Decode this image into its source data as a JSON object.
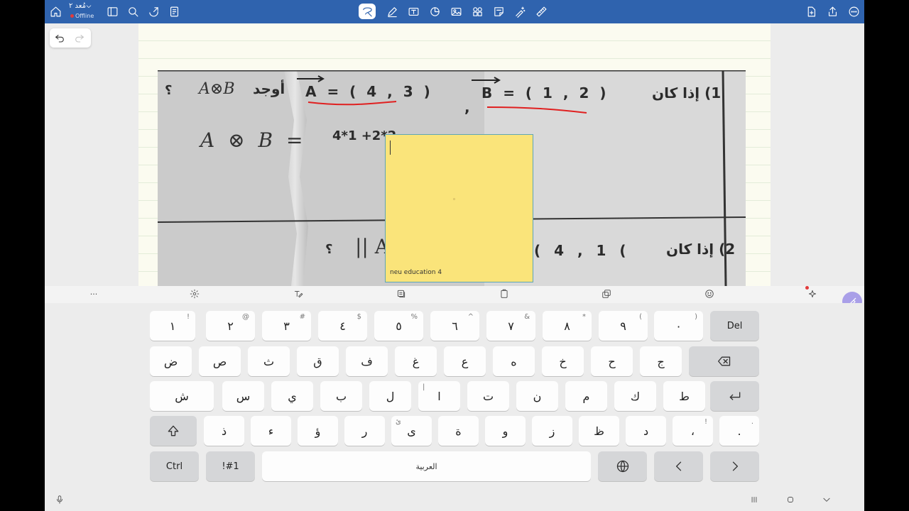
{
  "header": {
    "doc_title": "مُعد ٢",
    "doc_status": "Offline",
    "icons": [
      "home-icon",
      "chevron-down-icon",
      "sidebar-icon",
      "search-icon",
      "share-link-icon",
      "bookmark-icon",
      "lasso-select-icon",
      "pen-icon",
      "text-box-icon",
      "shapes-icon",
      "image-icon",
      "elements-icon",
      "sticky-note-icon",
      "magic-pen-icon",
      "ruler-icon",
      "add-page-icon",
      "export-icon",
      "more-icon"
    ]
  },
  "colors": {
    "toolbar": "#2f63ae",
    "sticky": "#fae47a",
    "annotation": "#e02020",
    "pen_fab": "#a99fe8"
  },
  "worksheet": {
    "line1_question": "1) إذا كان",
    "line1_b": "B = ( 1 , 2 )",
    "line1_a": "A = ( 4 , 3 )",
    "line1_find": "أوجد",
    "line1_expr": "A⊗B",
    "line1_qmark": "؟",
    "line2_expr": "A ⊗ B =",
    "line2_work": "4*1 +2*2",
    "line3_question": "2) إذا كان",
    "line3_vec": "( 4 , 1 (",
    "line3_norm": "|| A",
    "line3_qmark": "؟"
  },
  "sticky_note": {
    "footer": "neu education 4"
  },
  "keyboard": {
    "row1": [
      {
        "label": "١",
        "sub": "!"
      },
      {
        "label": "٢",
        "sub": "@"
      },
      {
        "label": "٣",
        "sub": "#"
      },
      {
        "label": "٤",
        "sub": "$"
      },
      {
        "label": "٥",
        "sub": "%"
      },
      {
        "label": "٦",
        "sub": "^"
      },
      {
        "label": "٧",
        "sub": "&"
      },
      {
        "label": "٨",
        "sub": "*"
      },
      {
        "label": "٩",
        "sub": "("
      },
      {
        "label": "٠",
        "sub": ")"
      }
    ],
    "del": "Del",
    "row2": [
      "ض",
      "ص",
      "ث",
      "ق",
      "ف",
      "غ",
      "ع",
      "ه",
      "خ",
      "ح",
      "ج"
    ],
    "row3": [
      "ش",
      "س",
      "ي",
      "ب",
      "ل",
      "ا",
      "ت",
      "ن",
      "م",
      "ك",
      "ط"
    ],
    "row3_subs": [
      "",
      "",
      "",
      "",
      "",
      "|",
      "",
      "",
      "",
      "",
      ""
    ],
    "row4": [
      {
        "label": "ذ",
        "sub": ""
      },
      {
        "label": "ء",
        "sub": ""
      },
      {
        "label": "ؤ",
        "sub": ""
      },
      {
        "label": "ر",
        "sub": ""
      },
      {
        "label": "ى",
        "sub": "ئ"
      },
      {
        "label": "ة",
        "sub": ""
      },
      {
        "label": "و",
        "sub": ""
      },
      {
        "label": "ز",
        "sub": ""
      },
      {
        "label": "ظ",
        "sub": ""
      },
      {
        "label": "د",
        "sub": ""
      },
      {
        "label": "،",
        "sub": "!"
      },
      {
        "label": ".",
        "sub": "."
      }
    ],
    "ctrl": "Ctrl",
    "symbols": "!#1",
    "space": "العربية",
    "toolbar_more": "···"
  }
}
